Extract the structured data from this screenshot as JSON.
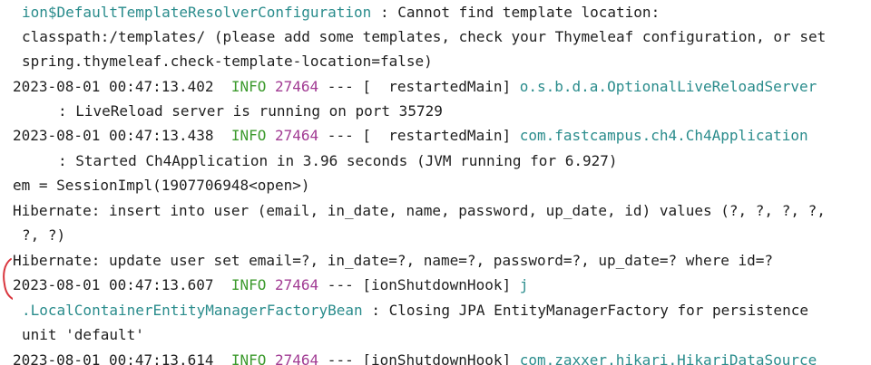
{
  "console": {
    "lines": [
      {
        "type": "text",
        "segments": [
          {
            "text": "ion$DefaultTemplateResolverConfiguration",
            "style": "class"
          },
          {
            "text": " : Cannot find template location:",
            "style": "plain"
          }
        ]
      },
      {
        "type": "text",
        "segments": [
          {
            "text": "classpath:/templates/ (please add some templates, check your Thymeleaf configuration, or set",
            "style": "plain"
          }
        ]
      },
      {
        "type": "text",
        "segments": [
          {
            "text": "spring.thymeleaf.check-template-location=false)",
            "style": "plain"
          }
        ]
      },
      {
        "type": "log",
        "date": "2023-08-01 00:47:13.402",
        "level": "INFO",
        "pid": "27464",
        "sep": " --- [",
        "thread": "  restartedMain",
        "close": "] ",
        "logger": "o.s.b.d.a.OptionalLiveReloadServer"
      },
      {
        "type": "text",
        "segments": [
          {
            "text": ": LiveReload server is running on port 35729",
            "style": "plain"
          }
        ]
      },
      {
        "type": "log",
        "date": "2023-08-01 00:47:13.438",
        "level": "INFO",
        "pid": "27464",
        "sep": " --- [",
        "thread": "  restartedMain",
        "close": "] ",
        "logger": "com.fastcampus.ch4.Ch4Application"
      },
      {
        "type": "text",
        "segments": [
          {
            "text": ": Started Ch4Application in 3.96 seconds (JVM running for 6.927)",
            "style": "plain"
          }
        ]
      },
      {
        "type": "text",
        "segments": [
          {
            "text": "em = SessionImpl(1907706948<open>)",
            "style": "plain"
          }
        ]
      },
      {
        "type": "text",
        "segments": [
          {
            "text": "Hibernate: insert into user (email, in_date, name, password, up_date, id) values (?, ?, ?, ?,",
            "style": "plain"
          }
        ]
      },
      {
        "type": "text",
        "segments": [
          {
            "text": "?, ?)",
            "style": "plain"
          }
        ]
      },
      {
        "type": "text",
        "segments": [
          {
            "text": "Hibernate: update user set email=?, in_date=?, name=?, password=?, up_date=? where id=?",
            "style": "plain"
          }
        ]
      },
      {
        "type": "log",
        "date": "2023-08-01 00:47:13.607",
        "level": "INFO",
        "pid": "27464",
        "sep": " --- [",
        "thread": "ionShutdownHook",
        "close": "] ",
        "logger": "j"
      },
      {
        "type": "text",
        "segments": [
          {
            "text": ".LocalContainerEntityManagerFactoryBean",
            "style": "class"
          },
          {
            "text": " : Closing JPA EntityManagerFactory for persistence",
            "style": "plain"
          }
        ]
      },
      {
        "type": "text",
        "segments": [
          {
            "text": "unit 'default'",
            "style": "plain"
          }
        ]
      },
      {
        "type": "log",
        "date": "2023-08-01 00:47:13.614",
        "level": "INFO",
        "pid": "27464",
        "sep": " --- [",
        "thread": "ionShutdownHook",
        "close": "] ",
        "logger": "com.zaxxer.hikari.HikariDataSource"
      }
    ]
  }
}
